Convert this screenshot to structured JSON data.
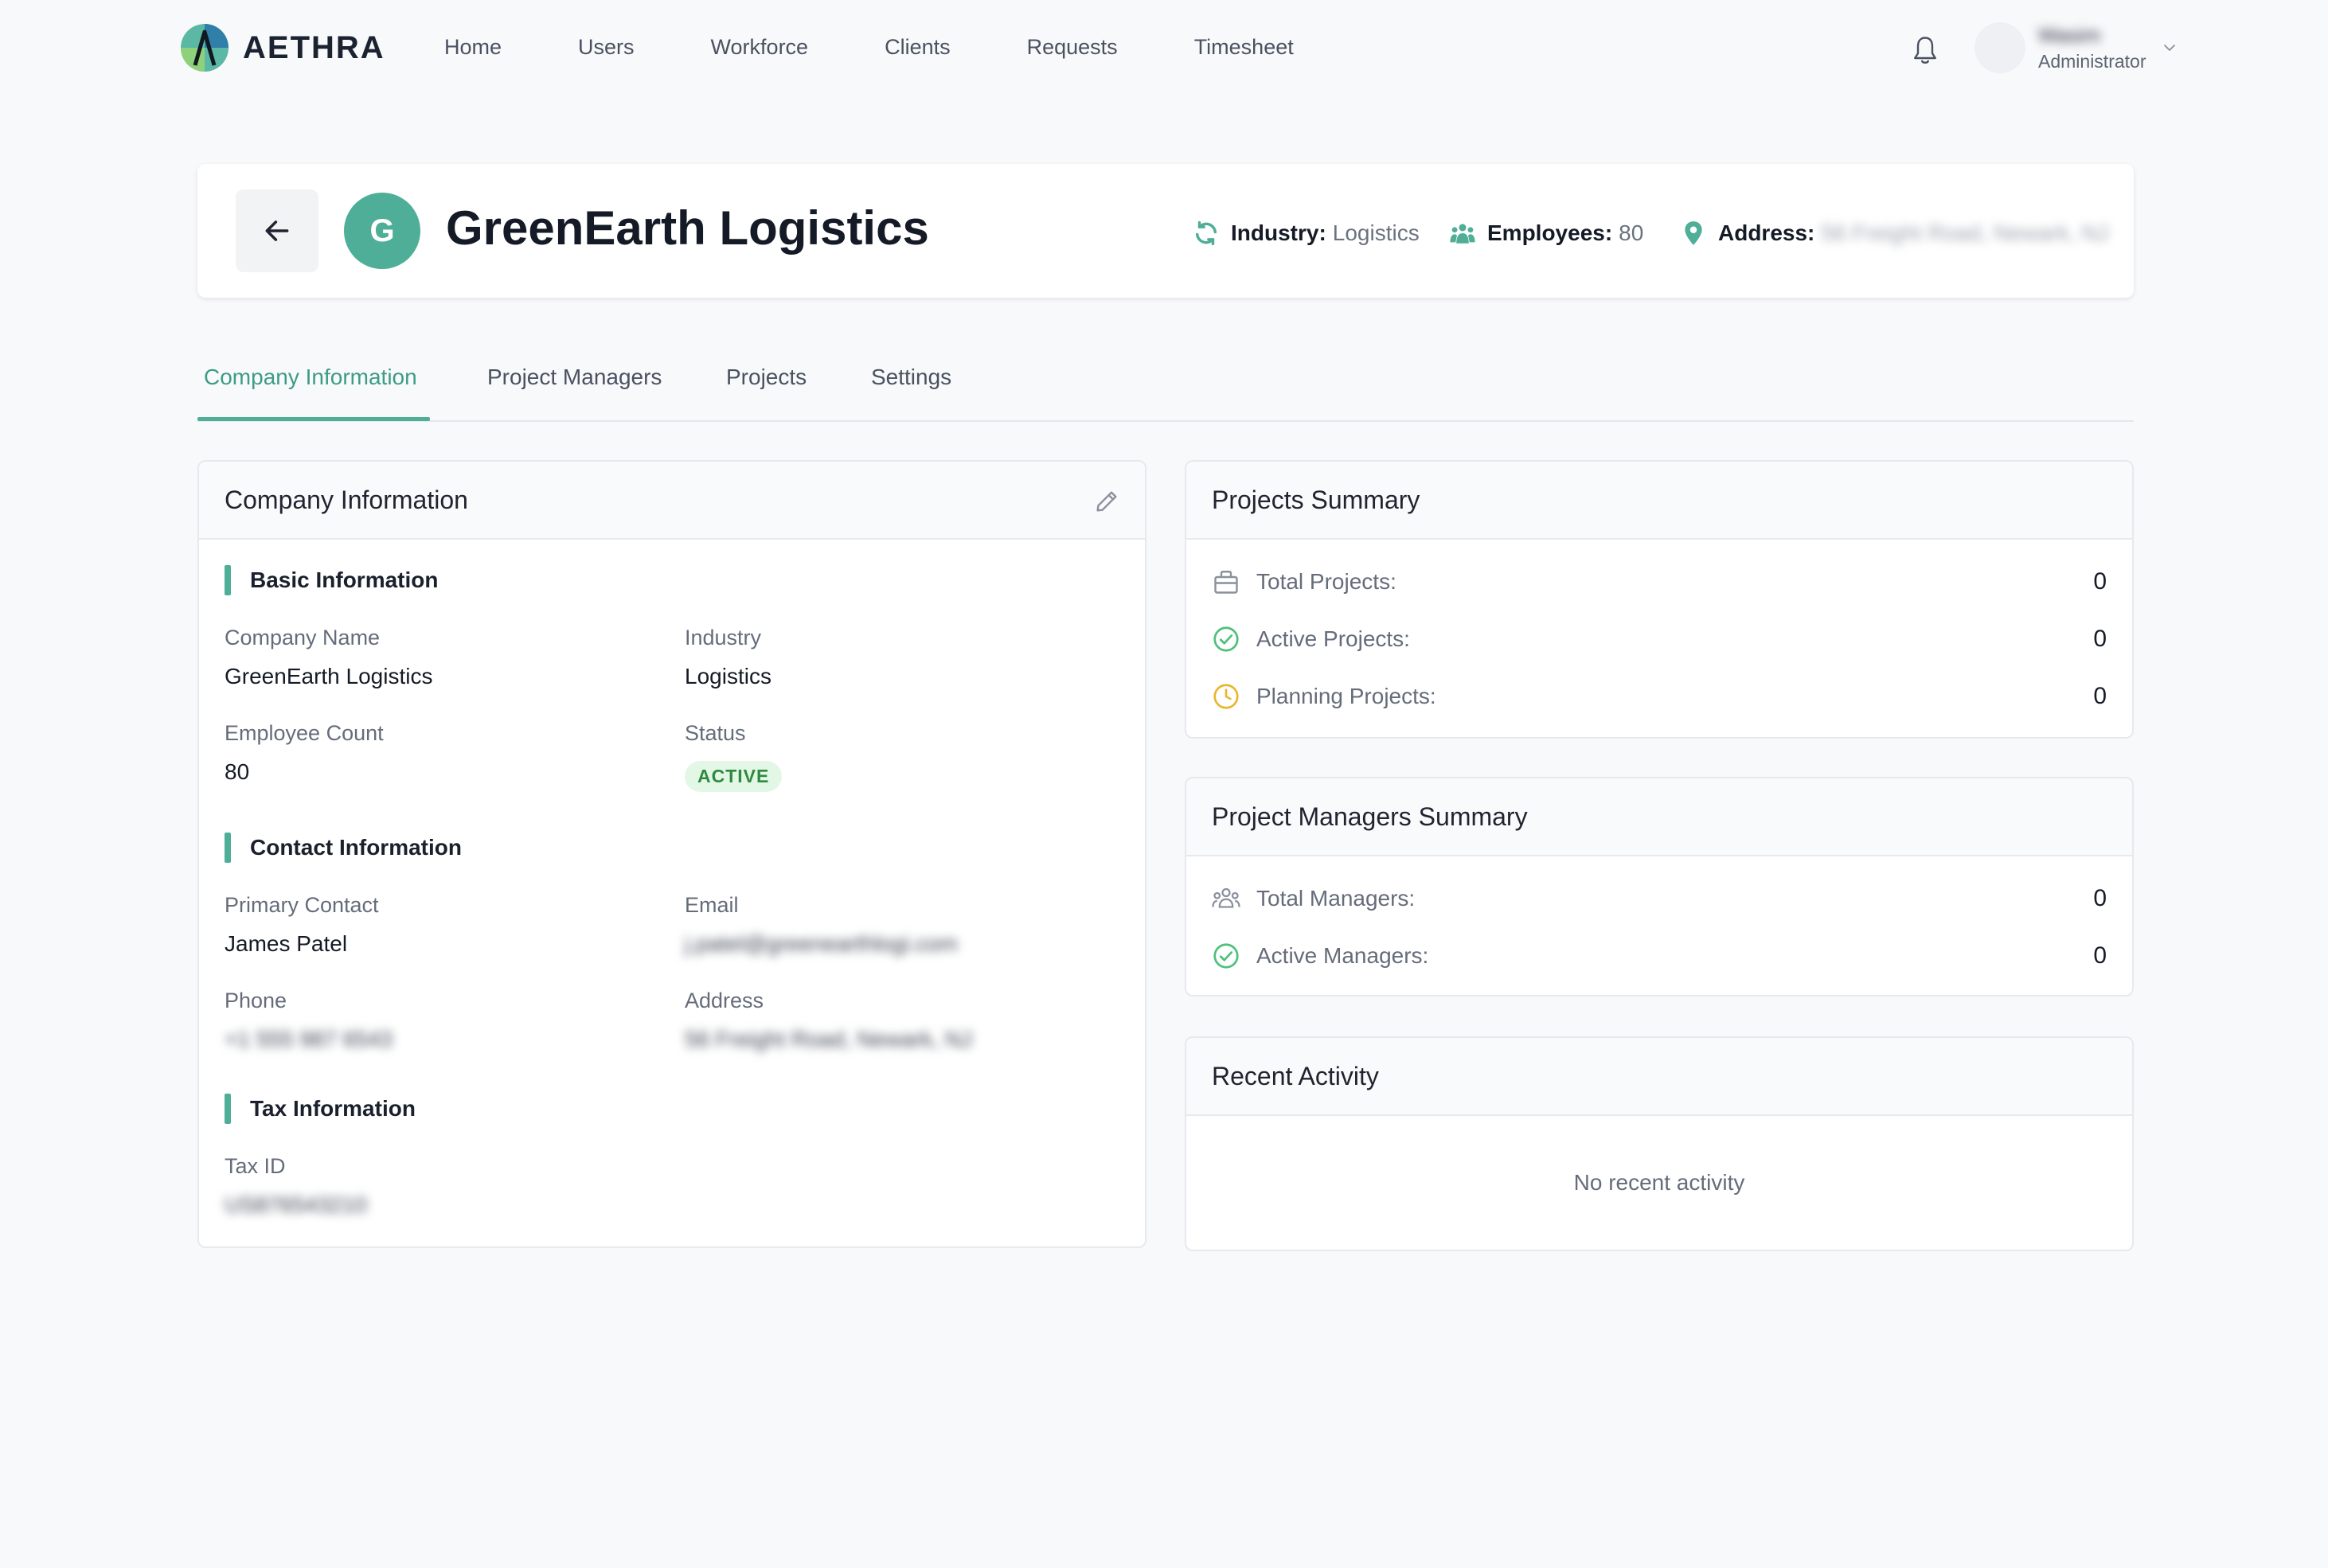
{
  "brand": {
    "name": "AETHRA",
    "accent": "#4fae98"
  },
  "nav": {
    "items": [
      "Home",
      "Users",
      "Workforce",
      "Clients",
      "Requests",
      "Timesheet"
    ]
  },
  "user": {
    "name": "Wasim",
    "role": "Administrator"
  },
  "company": {
    "initial": "G",
    "name": "GreenEarth Logistics",
    "industry_label": "Industry:",
    "industry": "Logistics",
    "employees_label": "Employees:",
    "employees": "80",
    "address_label": "Address:",
    "address": "56 Freight Road, Newark, NJ"
  },
  "tabs": [
    "Company Information",
    "Project Managers",
    "Projects",
    "Settings"
  ],
  "info_card": {
    "title": "Company Information",
    "basic": {
      "title": "Basic Information",
      "company_name_label": "Company Name",
      "company_name": "GreenEarth Logistics",
      "industry_label": "Industry",
      "industry": "Logistics",
      "employee_count_label": "Employee Count",
      "employee_count": "80",
      "status_label": "Status",
      "status": "ACTIVE"
    },
    "contact": {
      "title": "Contact Information",
      "primary_contact_label": "Primary Contact",
      "primary_contact": "James Patel",
      "email_label": "Email",
      "email": "j.patel@greenearthlogi.com",
      "phone_label": "Phone",
      "phone": "+1 555 987 6543",
      "address_label": "Address",
      "address": "56 Freight Road, Newark, NJ"
    },
    "tax": {
      "title": "Tax Information",
      "tax_id_label": "Tax ID",
      "tax_id": "US876543210"
    }
  },
  "projects_summary": {
    "title": "Projects Summary",
    "rows": [
      {
        "label": "Total Projects:",
        "value": "0",
        "icon": "briefcase-icon"
      },
      {
        "label": "Active Projects:",
        "value": "0",
        "icon": "check-circle-icon"
      },
      {
        "label": "Planning Projects:",
        "value": "0",
        "icon": "clock-icon"
      }
    ]
  },
  "managers_summary": {
    "title": "Project Managers Summary",
    "rows": [
      {
        "label": "Total Managers:",
        "value": "0",
        "icon": "users-icon"
      },
      {
        "label": "Active Managers:",
        "value": "0",
        "icon": "check-circle-icon"
      }
    ]
  },
  "recent_activity": {
    "title": "Recent Activity",
    "empty": "No recent activity"
  }
}
